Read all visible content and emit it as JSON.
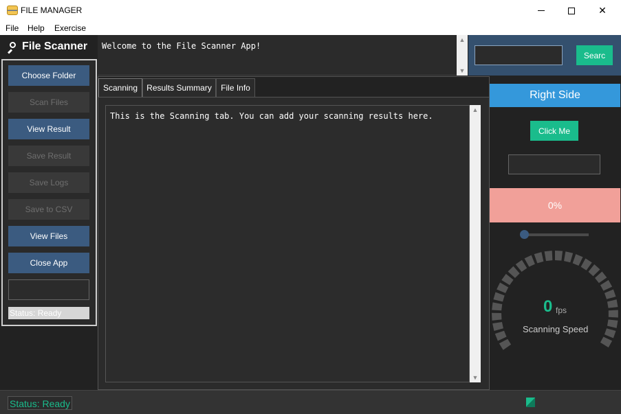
{
  "window": {
    "title": "FILE MANAGER"
  },
  "menu": {
    "items": [
      "File",
      "Help",
      "Exercise"
    ]
  },
  "left": {
    "header": "File Scanner",
    "buttons": [
      {
        "label": "Choose Folder",
        "state": "active"
      },
      {
        "label": "Scan Files",
        "state": "disabled"
      },
      {
        "label": "View Result",
        "state": "active"
      },
      {
        "label": "Save Result",
        "state": "disabled"
      },
      {
        "label": "Save Logs",
        "state": "disabled"
      },
      {
        "label": "Save to CSV",
        "state": "disabled"
      },
      {
        "label": "View Files",
        "state": "active"
      },
      {
        "label": "Close App",
        "state": "active"
      }
    ],
    "entry_value": "",
    "status": "Status: Ready"
  },
  "welcome": {
    "text": "Welcome to the File Scanner App!"
  },
  "search": {
    "input_value": "",
    "button_label": "Searc"
  },
  "notebook": {
    "tabs": [
      "Scanning",
      "Results Summary",
      "File Info"
    ],
    "selected_tab": "Scanning",
    "content": "This is the Scanning tab. You can add your scanning results here."
  },
  "right": {
    "header": "Right Side",
    "button_label": "Click Me",
    "entry_value": "",
    "progress_text": "0%",
    "progress_fraction": 0,
    "slider_fraction": 0,
    "gauge": {
      "value": "0",
      "unit": "fps",
      "label": "Scanning Speed"
    }
  },
  "statusbar": {
    "text": "Status: Ready"
  },
  "colors": {
    "accent_blue": "#3b5b80",
    "accent_green": "#1abc8c",
    "header_blue": "#3498db",
    "progress_red": "#f1a099",
    "background": "#222222"
  }
}
